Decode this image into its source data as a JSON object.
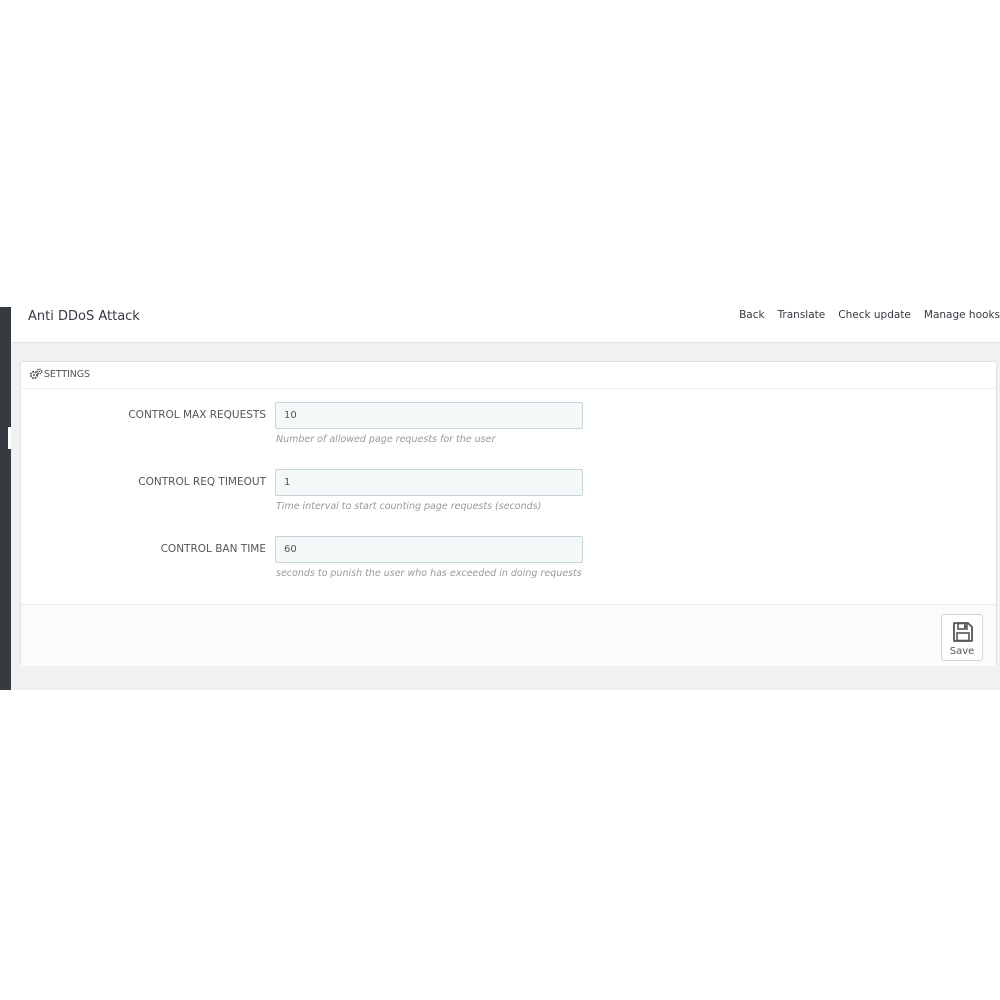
{
  "header": {
    "title": "Anti DDoS Attack",
    "links": [
      "Back",
      "Translate",
      "Check update",
      "Manage hooks"
    ]
  },
  "panel": {
    "heading": "SETTINGS",
    "heading_icon": "cogs-icon"
  },
  "fields": [
    {
      "label": "CONTROL MAX REQUESTS",
      "value": "10",
      "help": "Number of allowed page requests for the user"
    },
    {
      "label": "CONTROL REQ TIMEOUT",
      "value": "1",
      "help": "Time interval to start counting page requests (seconds)"
    },
    {
      "label": "CONTROL BAN TIME",
      "value": "60",
      "help": "seconds to punish the user who has exceeded in doing requests"
    }
  ],
  "footer": {
    "save_label": "Save",
    "save_icon": "save-icon"
  },
  "colors": {
    "sidebar": "#363a41",
    "background": "#f0f1f2",
    "input_bg": "#f5f8f9",
    "input_border": "#c7d6db"
  }
}
